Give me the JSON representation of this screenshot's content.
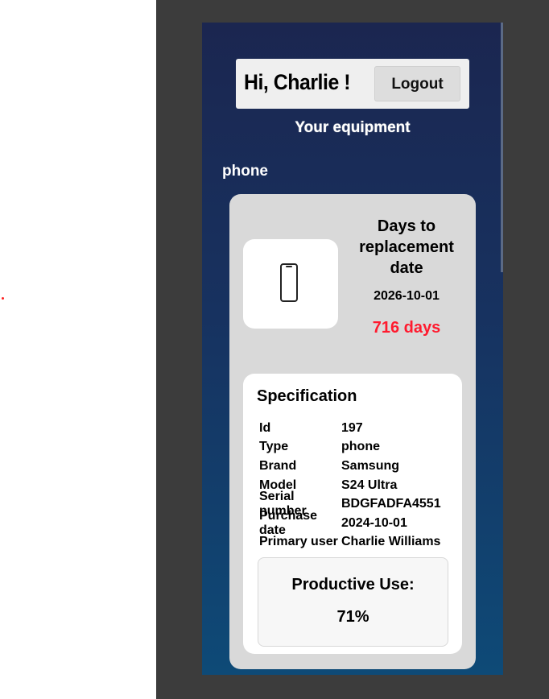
{
  "header": {
    "greeting": "Hi, Charlie !",
    "logout_label": "Logout"
  },
  "section_title": "Your equipment",
  "device": {
    "category_label": "phone",
    "icon": "smartphone-icon",
    "days_title": "Days to replacement date",
    "replacement_date": "2026-10-01",
    "days_remaining": "716 days"
  },
  "specification": {
    "title": "Specification",
    "rows": [
      {
        "key": "Id",
        "value": "197"
      },
      {
        "key": "Type",
        "value": "phone"
      },
      {
        "key": "Brand",
        "value": "Samsung"
      },
      {
        "key": "Model",
        "value": "S24 Ultra"
      },
      {
        "key": "Serial number",
        "value": "BDGFADFA4551"
      },
      {
        "key": "Purchase date",
        "value": "2024-10-01"
      },
      {
        "key": "Primary user",
        "value": "Charlie Williams"
      }
    ]
  },
  "productive_use": {
    "title": "Productive Use:",
    "value": "71%"
  },
  "colors": {
    "days_remaining": "#ff1a2e",
    "background_top": "#1b2650",
    "background_bottom": "#0e4a77"
  }
}
